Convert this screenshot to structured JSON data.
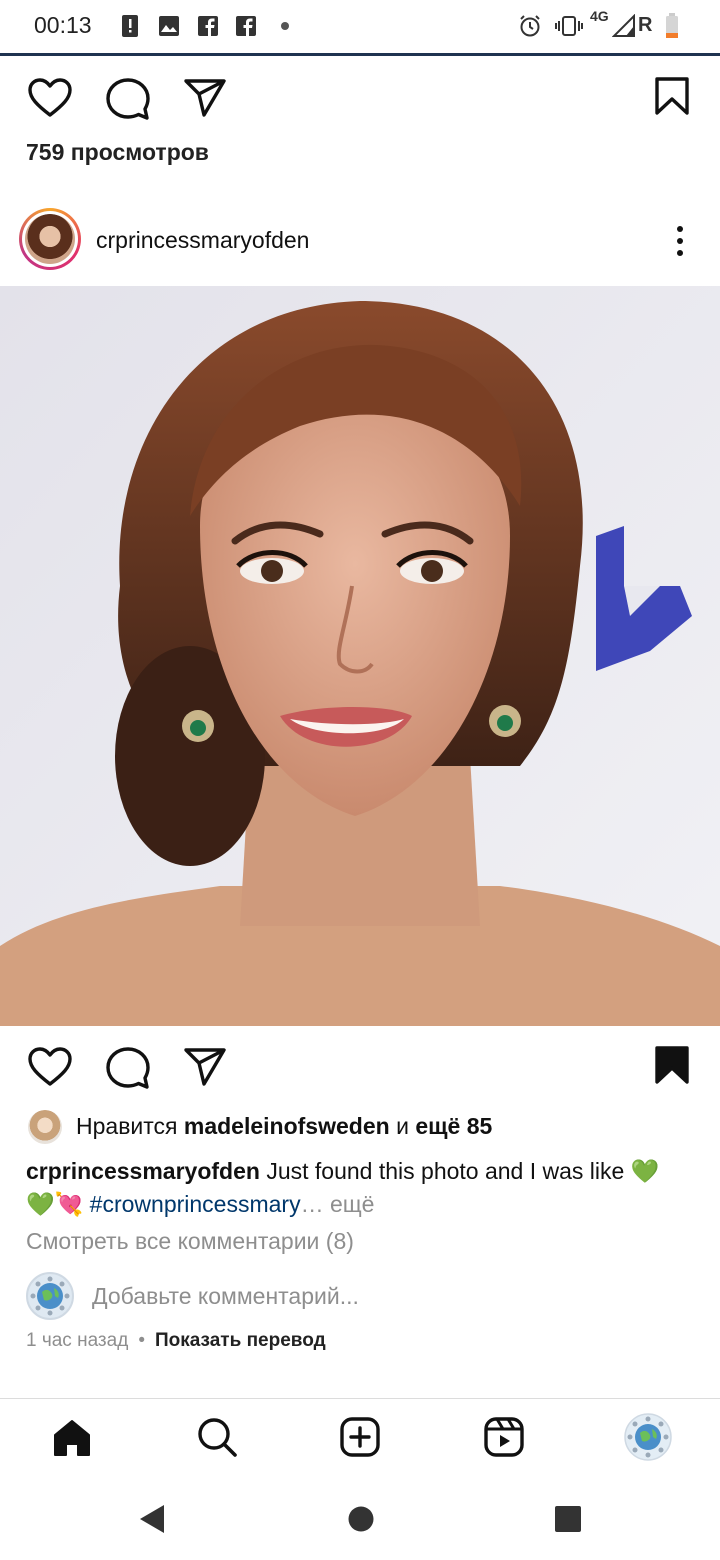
{
  "status_bar": {
    "time": "00:13",
    "network": "4G",
    "roaming": "R",
    "icons": [
      "alert-icon",
      "gallery-icon",
      "facebook-icon",
      "facebook-icon",
      "dot-icon",
      "alarm-icon",
      "vibrate-icon",
      "signal-icon",
      "battery-low-icon"
    ]
  },
  "top_actions": {
    "icons": [
      "heart-icon",
      "comment-icon",
      "share-icon",
      "bookmark-icon"
    ]
  },
  "views_text": "759 просмотров",
  "post": {
    "author": "crprincessmaryofden",
    "more_icon": "more-vertical-icon",
    "image_alt": "Portrait photo"
  },
  "post_actions": {
    "icons": [
      "heart-icon",
      "comment-icon",
      "share-icon",
      "bookmark-filled-icon"
    ]
  },
  "likes": {
    "prefix": "Нравится",
    "user": "madeleinofsweden",
    "and": "и",
    "more": "ещё 85"
  },
  "caption": {
    "username": "crprincessmaryofden",
    "text": "Just found this photo and I was like 💚",
    "emojis": "💚💘",
    "hashtag": "#crownprincessmary",
    "ellipsis": "…",
    "more": "ещё"
  },
  "view_comments": "Смотреть все комментарии (8)",
  "comment": {
    "placeholder": "Добавьте комментарий..."
  },
  "meta": {
    "time_ago": "1 час назад",
    "dot": "•",
    "translate": "Показать перевод"
  },
  "bottom_tabs": [
    "home-icon",
    "search-icon",
    "create-icon",
    "reels-icon",
    "profile-avatar"
  ],
  "system_nav": [
    "back-icon",
    "home-circle-icon",
    "recents-icon"
  ],
  "colors": {
    "accent_hashtag": "#00376b",
    "muted": "#8e8e8e",
    "status_line": "#1f3350"
  }
}
